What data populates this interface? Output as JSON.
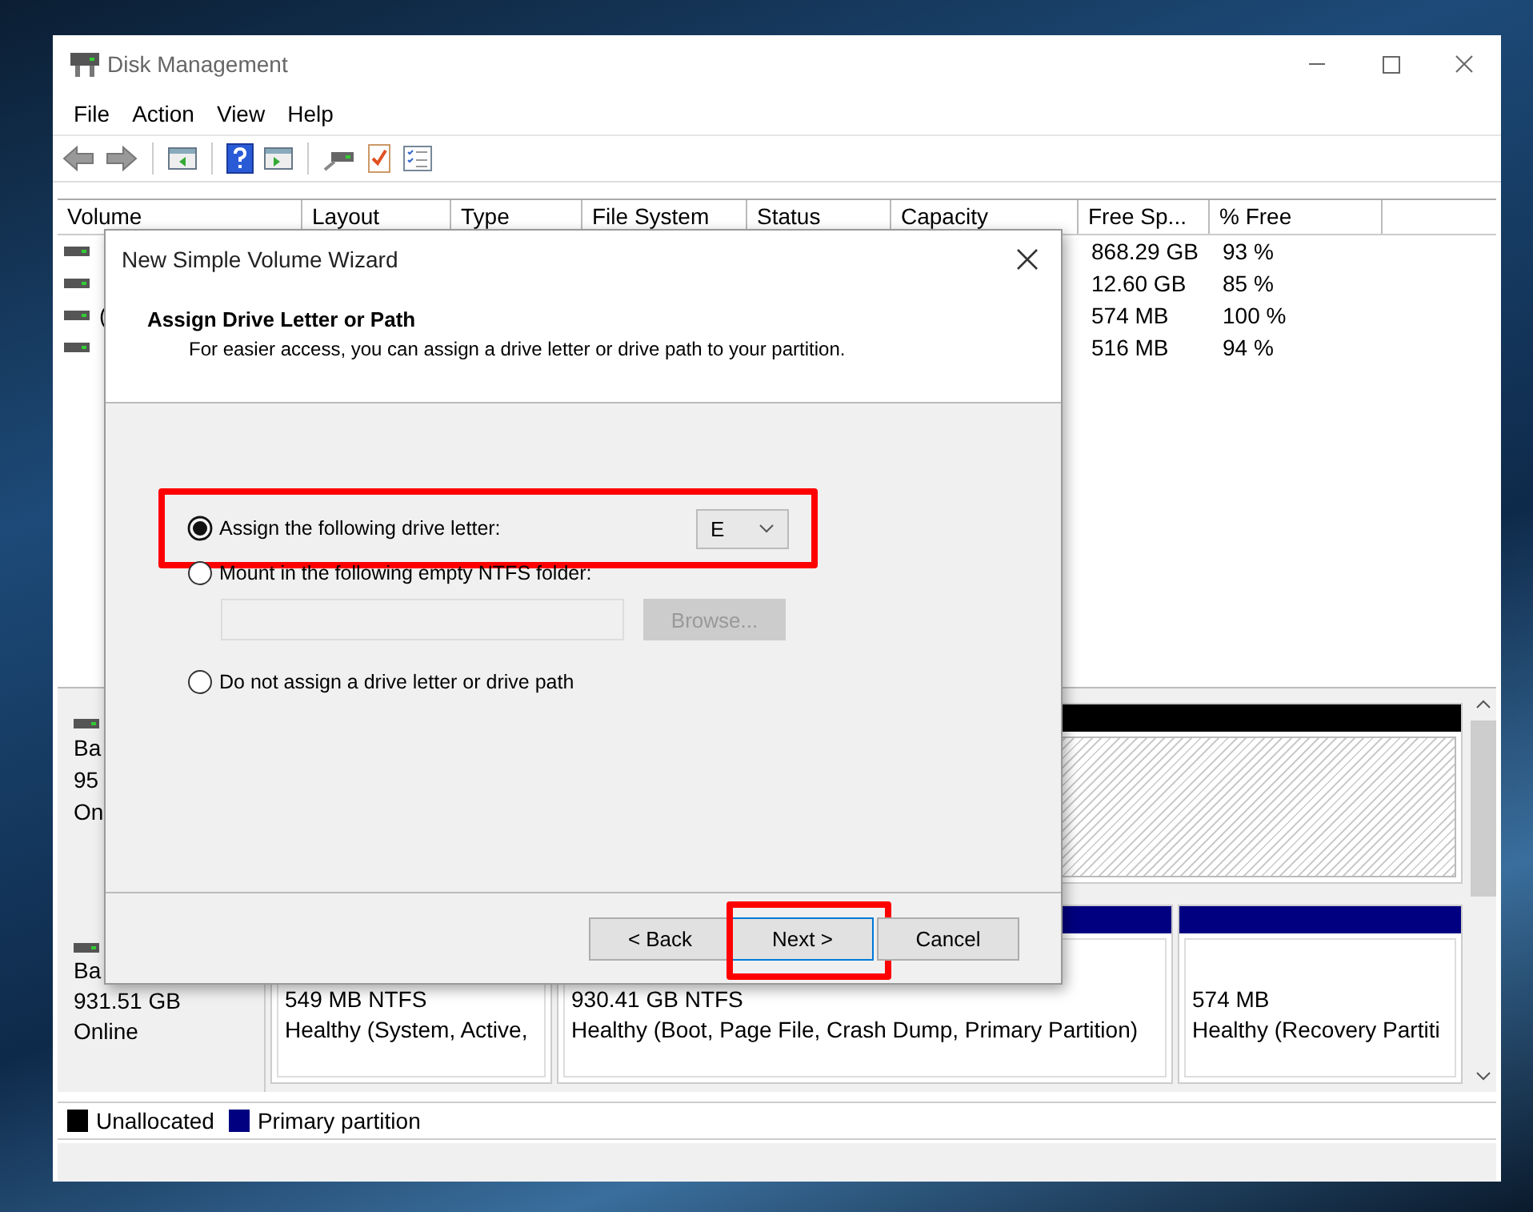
{
  "window": {
    "title": "Disk Management"
  },
  "menu": [
    "File",
    "Action",
    "View",
    "Help"
  ],
  "volume_list": {
    "columns": [
      "Volume",
      "Layout",
      "Type",
      "File System",
      "Status",
      "Capacity",
      "Free Sp...",
      "% Free"
    ],
    "rows": [
      {
        "free_space": "868.29 GB",
        "percent_free": "93 %"
      },
      {
        "free_space": "12.60 GB",
        "percent_free": "85 %"
      },
      {
        "volume": "(",
        "free_space": "574 MB",
        "percent_free": "100 %"
      },
      {
        "free_space": "516 MB",
        "percent_free": "94 %"
      }
    ]
  },
  "disks": [
    {
      "lines": [
        "Ba",
        "95",
        "On"
      ],
      "partitions": [
        {
          "kind": "unallocated"
        }
      ]
    },
    {
      "lines": [
        "Ba",
        "931.51 GB",
        "Online"
      ],
      "partitions": [
        {
          "kind": "primary",
          "size": "549 MB NTFS",
          "status": "Healthy (System, Active,"
        },
        {
          "kind": "primary",
          "size": "930.41 GB NTFS",
          "status": "Healthy (Boot, Page File, Crash Dump, Primary Partition)"
        },
        {
          "kind": "primary",
          "size": "574 MB",
          "status": "Healthy (Recovery Partiti"
        }
      ]
    }
  ],
  "legend": [
    {
      "kind": "unallocated",
      "label": "Unallocated",
      "color": "#000000"
    },
    {
      "kind": "primary",
      "label": "Primary partition",
      "color": "#000080"
    }
  ],
  "dialog": {
    "title": "New Simple Volume Wizard",
    "heading": "Assign Drive Letter or Path",
    "description": "For easier access, you can assign a drive letter or drive path to your partition.",
    "options": [
      {
        "label": "Assign the following drive letter:",
        "selected": true,
        "highlighted": true
      },
      {
        "label": "Mount in the following empty NTFS folder:",
        "selected": false,
        "highlighted": false
      },
      {
        "label": "Do not assign a drive letter or drive path",
        "selected": false,
        "highlighted": false
      }
    ],
    "drive_letter": "E",
    "folder_field": {
      "disabled": true
    },
    "browse_button": {
      "label": "Browse...",
      "disabled": true
    },
    "buttons": [
      {
        "label": "< Back",
        "default": false,
        "highlighted": false
      },
      {
        "label": "Next >",
        "default": true,
        "highlighted": true
      },
      {
        "label": "Cancel",
        "default": false,
        "highlighted": false
      }
    ]
  }
}
